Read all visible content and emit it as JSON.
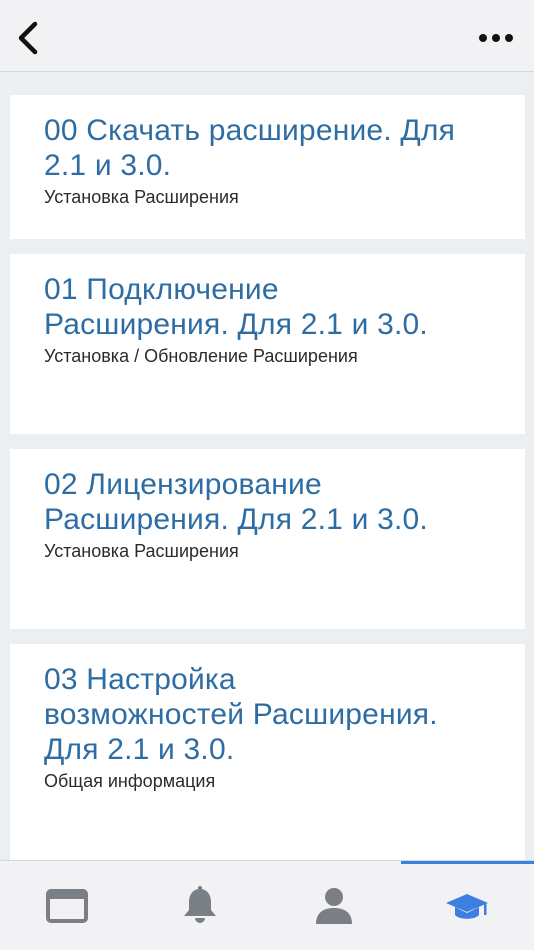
{
  "top_bar": {
    "back_icon": "chevron-left-icon",
    "more_icon": "more-horizontal-icon"
  },
  "cards": [
    {
      "title": "00 Скачать расширение. Для 2.1 и 3.0.",
      "subtitle": "Установка Расширения"
    },
    {
      "title": "01 Подключение Расширения. Для 2.1 и 3.0.",
      "subtitle": "Установка / Обновление Расширения"
    },
    {
      "title": "02 Лицензирование Расширения. Для 2.1 и 3.0.",
      "subtitle": "Установка Расширения"
    },
    {
      "title": "03 Настройка возможностей Расширения. Для 2.1 и 3.0.",
      "subtitle": "Общая информация"
    }
  ],
  "tab_bar": {
    "active_index": 3,
    "active_color": "#3d7fe0",
    "inactive_color": "#7a7f85",
    "tabs": [
      {
        "icon": "browser-window-icon"
      },
      {
        "icon": "bell-icon"
      },
      {
        "icon": "user-icon"
      },
      {
        "icon": "graduation-cap-icon"
      }
    ]
  }
}
